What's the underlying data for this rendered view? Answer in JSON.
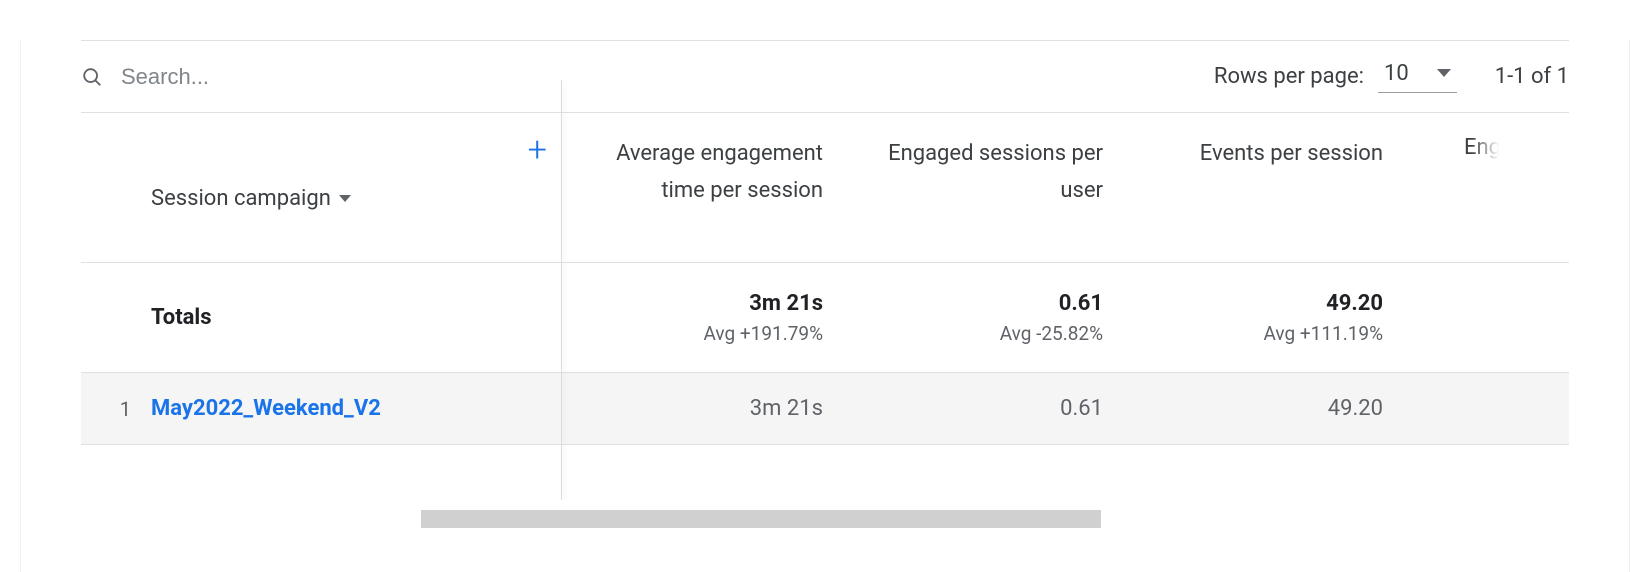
{
  "search": {
    "placeholder": "Search..."
  },
  "pagination": {
    "rows_per_page_label": "Rows per page:",
    "rows_per_page_value": "10",
    "range_text": "1-1 of 1"
  },
  "dimension": {
    "label": "Session campaign"
  },
  "columns": {
    "avg_engagement": "Average engagement time per session",
    "engaged_sessions": "Engaged sessions per user",
    "events_per_session": "Events per session",
    "peek": "Eng"
  },
  "totals": {
    "label": "Totals",
    "avg_engagement": {
      "value": "3m 21s",
      "delta": "Avg +191.79%"
    },
    "engaged_sessions": {
      "value": "0.61",
      "delta": "Avg -25.82%"
    },
    "events_per_session": {
      "value": "49.20",
      "delta": "Avg +111.19%"
    }
  },
  "rows": [
    {
      "index": "1",
      "name": "May2022_Weekend_V2",
      "avg_engagement": "3m 21s",
      "engaged_sessions": "0.61",
      "events_per_session": "49.20"
    }
  ]
}
